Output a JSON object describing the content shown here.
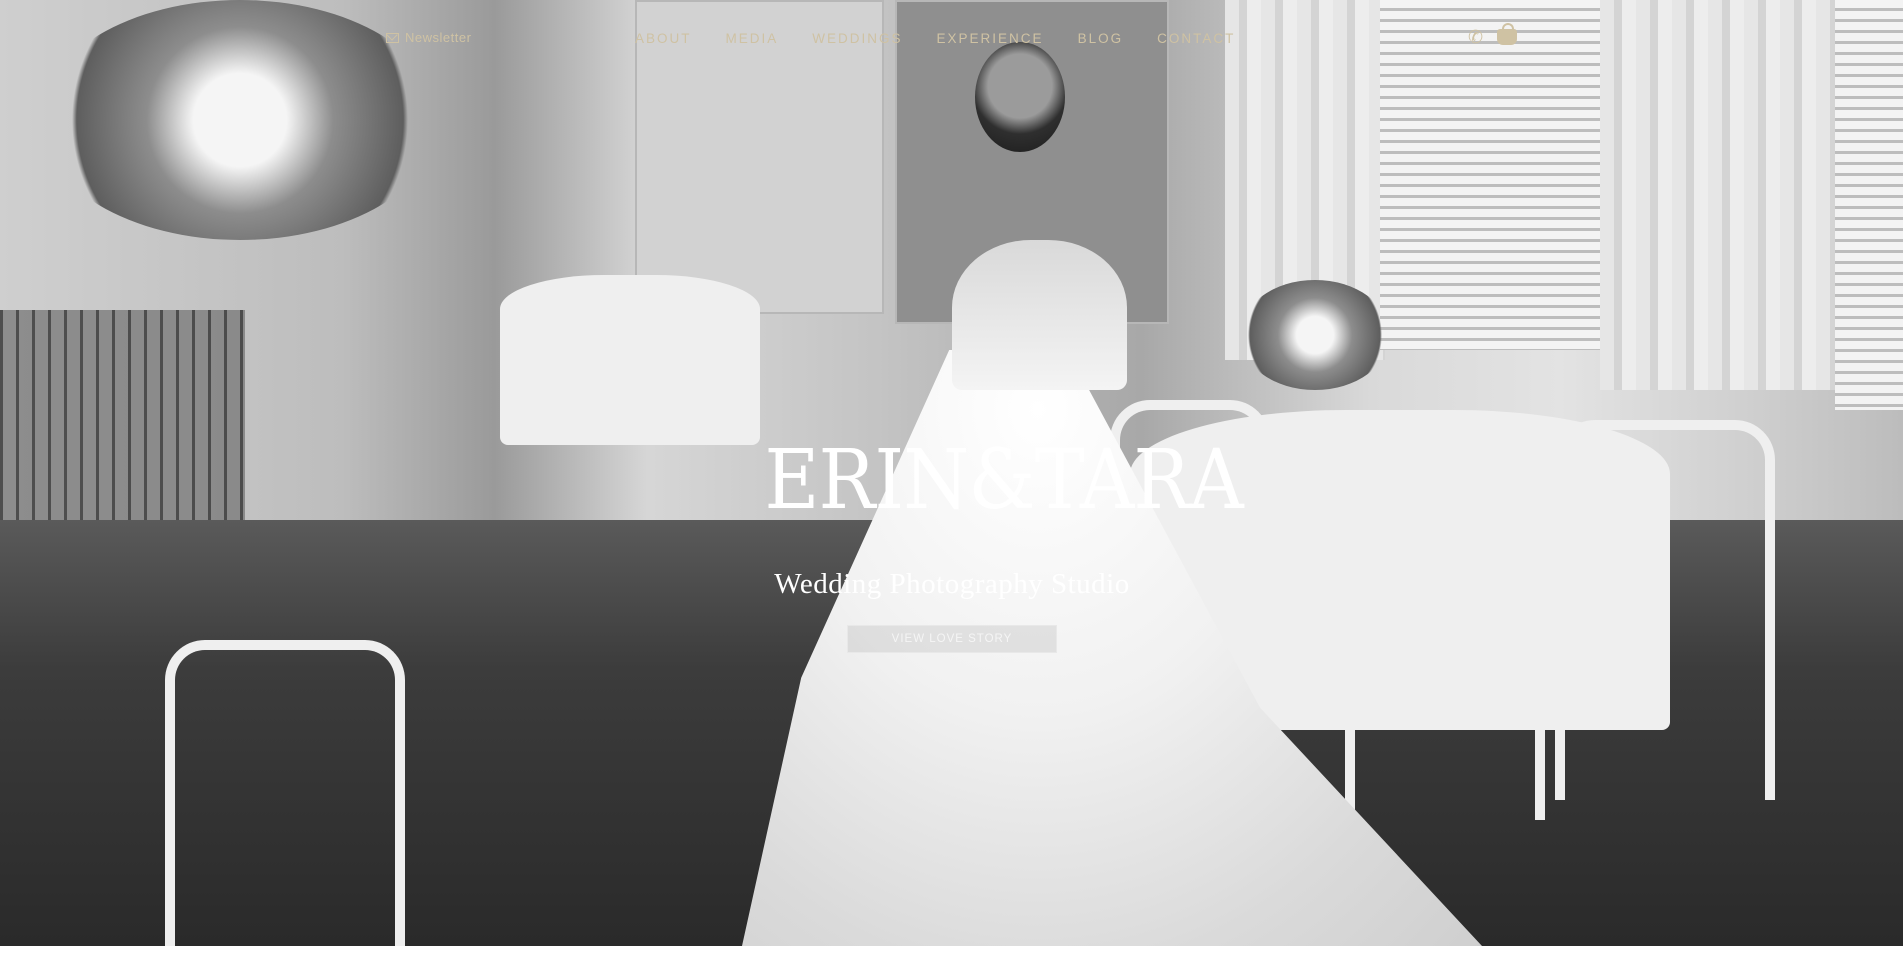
{
  "header": {
    "newsletter_label": "Newsletter",
    "nav": [
      {
        "label": "ABOUT"
      },
      {
        "label": "MEDIA"
      },
      {
        "label": "WEDDINGS"
      },
      {
        "label": "EXPERIENCE"
      },
      {
        "label": "BLOG"
      },
      {
        "label": "CONTACT"
      }
    ],
    "icons": {
      "phone": "phone-icon",
      "cart": "shopping-bag-icon"
    }
  },
  "hero": {
    "logo_text": "ERIN&TARA",
    "tagline": "Wedding Photography Studio",
    "cta_label": "VIEW LOVE STORY"
  },
  "colors": {
    "nav_text": "#cfc2a3",
    "hero_text": "#ffffff"
  }
}
